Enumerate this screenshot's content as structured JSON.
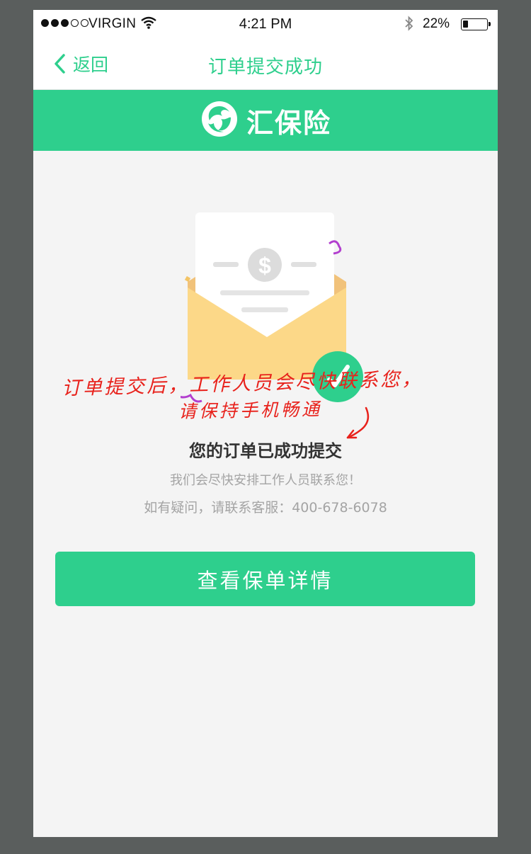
{
  "status_bar": {
    "carrier": "VIRGIN",
    "time": "4:21 PM",
    "battery_percent": "22%",
    "battery_level": 0.22,
    "signal_dots_filled": 3,
    "signal_dots_total": 5
  },
  "nav": {
    "back_label": "返回",
    "title": "订单提交成功"
  },
  "brand": {
    "name": "汇保险",
    "color": "#2ecf8d"
  },
  "annotation": {
    "line1": "订单提交后，工作人员会尽快联系您，",
    "line2": "请保持手机畅通",
    "color": "#e8221c"
  },
  "result": {
    "title": "您的订单已成功提交",
    "subtitle": "我们会尽快安排工作人员联系您！",
    "service_prefix": "如有疑问，请联系客服：",
    "service_phone": "400-678-6078"
  },
  "actions": {
    "view_policy_label": "查看保单详情"
  },
  "icons": {
    "back": "chevron-left-icon",
    "wifi": "wifi-icon",
    "bluetooth": "bluetooth-icon",
    "battery": "battery-icon",
    "logo": "swirl-logo-icon",
    "envelope": "envelope-illustration",
    "dollar": "dollar-coin-icon",
    "check": "check-badge-icon",
    "arrow": "hand-drawn-arrow-icon"
  }
}
